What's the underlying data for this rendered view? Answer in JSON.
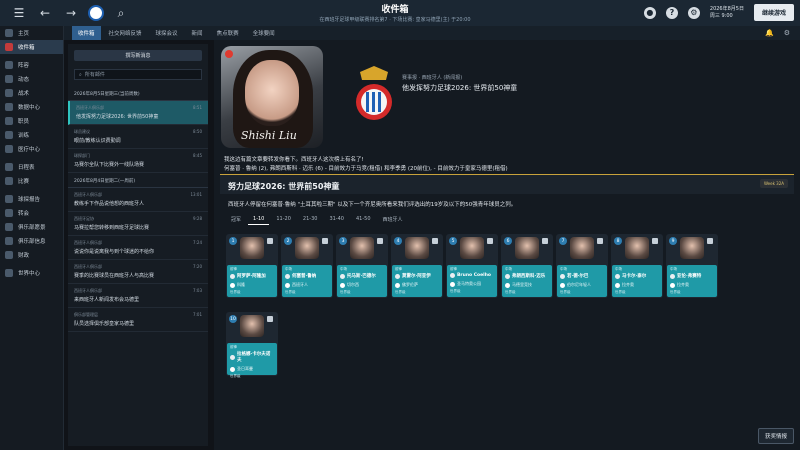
{
  "topbar": {
    "title": "收件箱",
    "subtitle": "在西班牙足球甲级联赛排名第7 · 下场比赛: 皇家马德里(主) 于20:00",
    "date_line1": "2026年8月5日",
    "date_line2": "周三 9:00",
    "continue_label": "继续游戏",
    "help": "?"
  },
  "sidebar": {
    "items": [
      {
        "label": "主页"
      },
      {
        "label": "收件箱",
        "active": true
      },
      {
        "label": "阵容"
      },
      {
        "label": "动态"
      },
      {
        "label": "战术"
      },
      {
        "label": "数据中心"
      },
      {
        "label": "职员"
      },
      {
        "label": "训练"
      },
      {
        "label": "医疗中心"
      },
      {
        "label": "日程表"
      },
      {
        "label": "比赛"
      },
      {
        "label": "球探报告"
      },
      {
        "label": "转会"
      },
      {
        "label": "俱乐部愿景"
      },
      {
        "label": "俱乐部信息"
      },
      {
        "label": "财政"
      },
      {
        "label": "世界中心"
      }
    ]
  },
  "tabs": {
    "items": [
      {
        "label": "收件箱",
        "active": true
      },
      {
        "label": "社交网络反馈"
      },
      {
        "label": "球探会议"
      },
      {
        "label": "新闻"
      },
      {
        "label": "焦点联赛"
      },
      {
        "label": "全球要闻"
      }
    ]
  },
  "inbox": {
    "new_label": "撰写新消息",
    "search_placeholder": "所有邮件",
    "groups": [
      {
        "header": "2026年8月5日星期三(当前周数)",
        "messages": [
          {
            "from": "西班牙人俱乐部",
            "subject": "他发挥努力足球2026: 世界前50神童",
            "time": "8:51",
            "selected": true
          },
          {
            "from": "球员建议",
            "subject": "眼前/教练认识费勤调",
            "time": "8:50"
          },
          {
            "from": "球探部门",
            "subject": "马赛尔全队下比赛外一线队场赛",
            "time": "8:45"
          }
        ]
      },
      {
        "header": "2026年8月4日星期二(一周前)",
        "messages": [
          {
            "from": "西班牙人俱乐部",
            "subject": "教练手下作品说他想的西班牙人",
            "time": "13:01"
          },
          {
            "from": "西班牙足协",
            "subject": "马赛拉帮您转移到西班牙足球比赛",
            "time": "9:28"
          },
          {
            "from": "西班牙人俱乐部",
            "subject": "说说你是说离我与到个球迷的不给你",
            "time": "7:24"
          },
          {
            "from": "西班牙人俱乐部",
            "subject": "赛季的比赛球员在西班牙人与高比赛",
            "time": "7:20"
          },
          {
            "from": "西班牙人俱乐部",
            "subject": "来西班牙人新闻发布会马德里",
            "time": "7:03"
          },
          {
            "from": "俱乐部管理层",
            "subject": "队员选择俱乐部皇家马德里",
            "time": "7:01"
          }
        ]
      }
    ]
  },
  "message": {
    "from": "赛事报 · 西班牙人 (新闻报)",
    "subject": "他发挥努力足球2026: 世界前50神童",
    "desc_line1": "我这边有篇文章要转发你看下。西班牙人这次榜上有名了!",
    "desc_line2": "何塞普 · 鲁纳 (2), 弗朗西斯科 · 迈乐 (6) - 目前效力于马竞(租借) 和李季勇 (20前位), - 目前效力于皇家马德里(租借)",
    "photo_signature": "Shishi Liu",
    "banner_title": "努力足球2026: 世界前50神童",
    "banner_badge": "Week 32A",
    "intro": "西班牙人停留在何塞普·鲁纳 \"土耳其啦三期\" 以及下一个齐尼奥所看来我们评选出的19岁及以下的50强青年球员之列。",
    "rank_tabs": [
      {
        "label": "冠军"
      },
      {
        "label": "1-10",
        "active": true
      },
      {
        "label": "11-20"
      },
      {
        "label": "21-30"
      },
      {
        "label": "31-40"
      },
      {
        "label": "41-50"
      },
      {
        "label": "西班牙人"
      }
    ],
    "cards": [
      {
        "num": "1",
        "pos": "前锋",
        "name": "阿罗萨·阿隆加",
        "club": "科隆",
        "level": "世界级"
      },
      {
        "num": "2",
        "pos": "中场",
        "name": "何塞普·鲁纳",
        "club": "西班牙人",
        "level": "世界级"
      },
      {
        "num": "3",
        "pos": "中场",
        "name": "托马斯·巴德尔",
        "club": "切尔西",
        "level": "世界级"
      },
      {
        "num": "4",
        "pos": "前锋",
        "name": "莫雷尔·阿亚伊",
        "club": "佛罗伦萨",
        "level": "世界级"
      },
      {
        "num": "5",
        "pos": "前锋",
        "name": "Bruno Coelho",
        "club": "圣马特奥公园",
        "level": "世界级"
      },
      {
        "num": "6",
        "pos": "中场",
        "name": "弗朗西斯科·迈乐",
        "club": "马德里竞技",
        "level": "世界级"
      },
      {
        "num": "7",
        "pos": "中场",
        "name": "若·德·尔巴",
        "club": "伯尔尼年轻人",
        "level": "世界级"
      },
      {
        "num": "8",
        "pos": "中场",
        "name": "马卡尔·泰尔",
        "club": "拉齐奥",
        "level": "世界级"
      },
      {
        "num": "9",
        "pos": "中场",
        "name": "亚伦·弗赛特",
        "club": "拉齐奥",
        "level": "世界级"
      },
      {
        "num": "10",
        "pos": "前锋",
        "name": "拉格娜·卡尔夫诺夫",
        "club": "圣日耳曼",
        "level": "世界级"
      }
    ],
    "bottom_button": "获奖情报"
  }
}
